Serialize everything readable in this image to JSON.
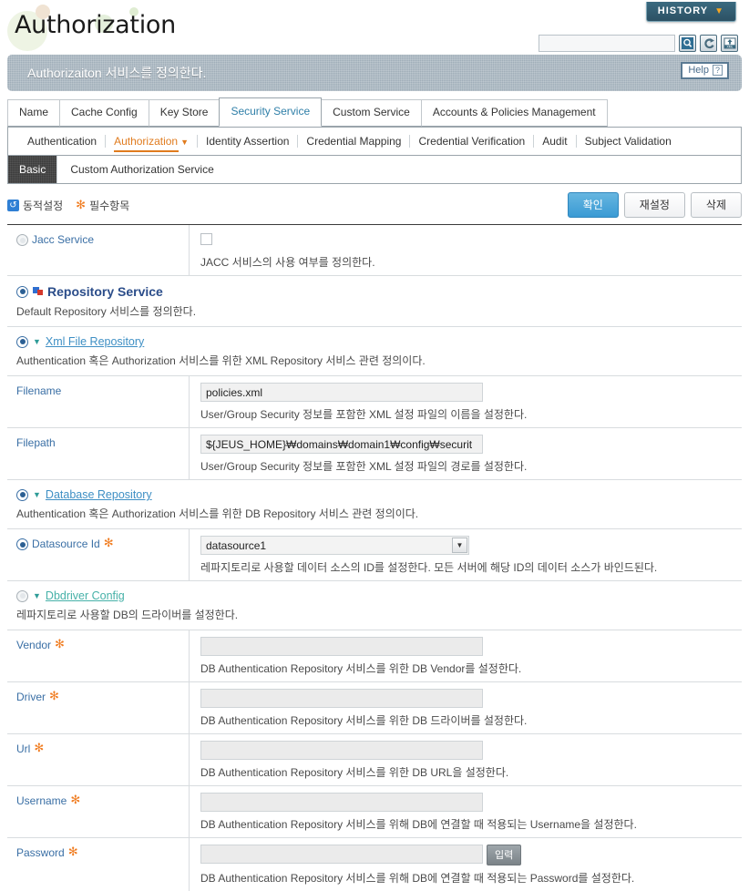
{
  "header": {
    "title": "Authorization",
    "history_label": "HISTORY",
    "history_caret": "▼",
    "search_value": "",
    "search_placeholder": "",
    "icons": {
      "search": "magnifier-icon",
      "refresh": "reload-icon",
      "xml": "xml-export-icon"
    }
  },
  "banner": {
    "text": "Authorizaiton 서비스를 정의한다.",
    "help_label": "Help",
    "help_mark": "?"
  },
  "tabs": {
    "main": [
      {
        "label": "Name",
        "active": false
      },
      {
        "label": "Cache Config",
        "active": false
      },
      {
        "label": "Key Store",
        "active": false
      },
      {
        "label": "Security Service",
        "active": true
      },
      {
        "label": "Custom Service",
        "active": false
      },
      {
        "label": "Accounts & Policies Management",
        "active": false
      }
    ],
    "sub": [
      {
        "label": "Authentication",
        "active": false
      },
      {
        "label": "Authorization",
        "active": true
      },
      {
        "label": "Identity Assertion",
        "active": false
      },
      {
        "label": "Credential Mapping",
        "active": false
      },
      {
        "label": "Credential Verification",
        "active": false
      },
      {
        "label": "Audit",
        "active": false
      },
      {
        "label": "Subject Validation",
        "active": false
      }
    ],
    "third": [
      {
        "label": "Basic",
        "active": true
      },
      {
        "label": "Custom Authorization Service",
        "active": false
      }
    ]
  },
  "actionbar": {
    "legend_dynamic": "동적설정",
    "legend_required": "필수항목",
    "confirm_label": "확인",
    "reset_label": "재설정",
    "delete_label": "삭제"
  },
  "form": {
    "jacc": {
      "label": "Jacc Service",
      "checked": false,
      "desc": "JACC 서비스의 사용 여부를 정의한다."
    },
    "repository_service": {
      "title": "Repository Service",
      "desc": "Default Repository 서비스를 정의한다."
    },
    "xml_file_repository": {
      "title": "Xml File Repository",
      "desc": "Authentication 혹은 Authorization 서비스를 위한 XML Repository 서비스 관련 정의이다.",
      "fields": [
        {
          "label": "Filename",
          "value": "policies.xml",
          "desc": "User/Group Security 정보를 포함한 XML 설정 파일의 이름을 설정한다."
        },
        {
          "label": "Filepath",
          "value": "${JEUS_HOME}₩domains₩domain1₩config₩securit",
          "desc": "User/Group Security 정보를 포함한 XML 설정 파일의 경로를 설정한다."
        }
      ]
    },
    "database_repository": {
      "title": "Database Repository",
      "desc": "Authentication 혹은 Authorization 서비스를 위한 DB Repository 서비스 관련 정의이다.",
      "datasource": {
        "label": "Datasource Id",
        "value": "datasource1",
        "desc": "레파지토리로 사용할 데이터 소스의 ID를 설정한다. 모든 서버에 해당 ID의 데이터 소스가 바인드된다."
      }
    },
    "dbdriver_config": {
      "title": "Dbdriver Config",
      "desc": "레파지토리로 사용할 DB의 드라이버를 설정한다.",
      "fields": [
        {
          "label": "Vendor",
          "value": "",
          "desc": "DB Authentication Repository 서비스를 위한 DB Vendor를 설정한다.",
          "button": ""
        },
        {
          "label": "Driver",
          "value": "",
          "desc": "DB Authentication Repository 서비스를 위한 DB 드라이버를 설정한다.",
          "button": ""
        },
        {
          "label": "Url",
          "value": "",
          "desc": "DB Authentication Repository 서비스를 위한 DB URL을 설정한다.",
          "button": ""
        },
        {
          "label": "Username",
          "value": "",
          "desc": "DB Authentication Repository 서비스를 위해 DB에 연결할 때 적용되는 Username을 설정한다.",
          "button": ""
        },
        {
          "label": "Password",
          "value": "",
          "desc": "DB Authentication Repository 서비스를 위해 DB에 연결할 때 적용되는 Password를 설정한다.",
          "button": "입력"
        }
      ]
    },
    "required_mark": "✻"
  },
  "colors": {
    "accent_orange": "#e07b1e",
    "link_blue": "#3e8fc4",
    "link_teal": "#46b1a8",
    "primary_button": "#3a9ad4",
    "banner_gray": "#9fadb8"
  }
}
